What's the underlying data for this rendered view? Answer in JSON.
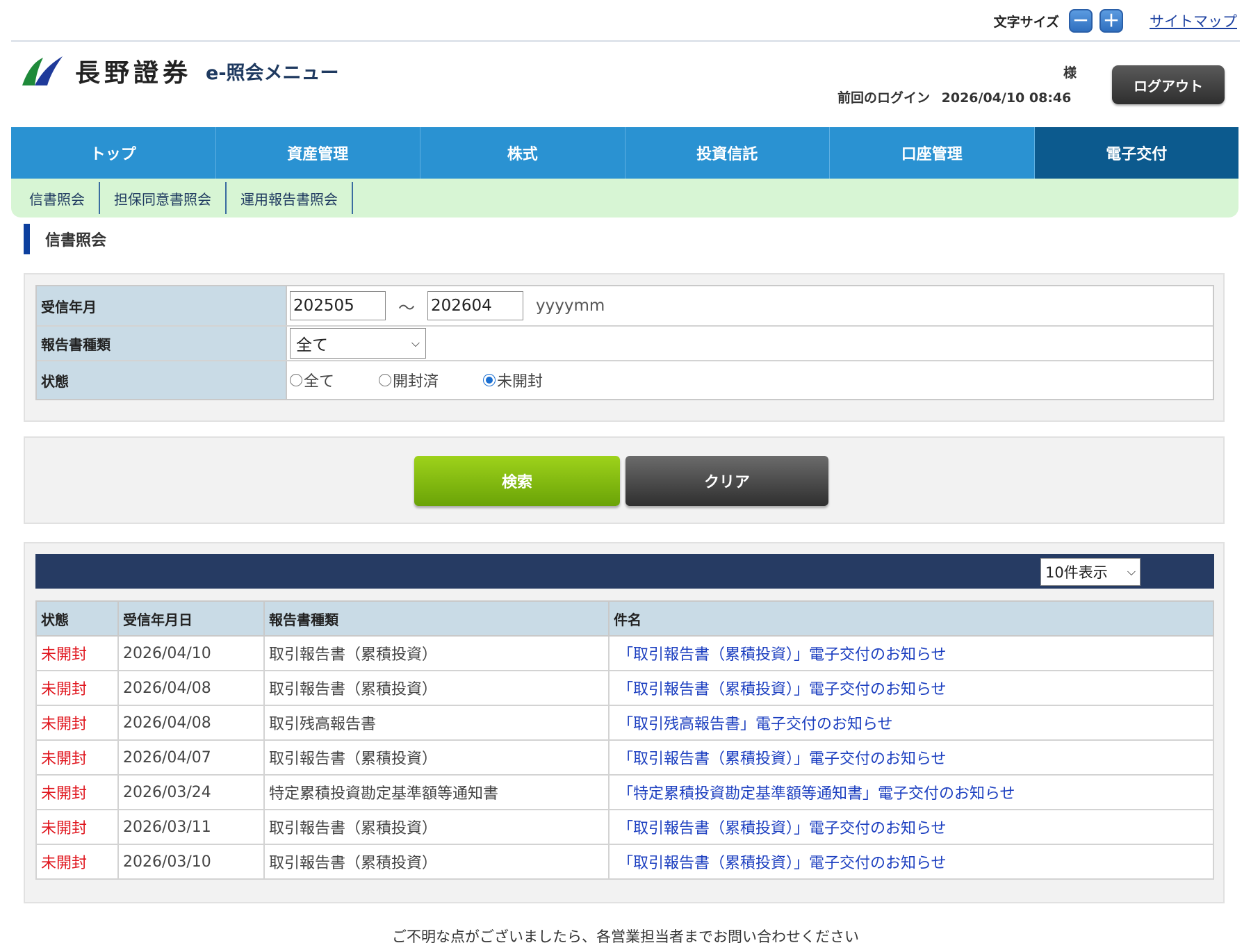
{
  "utility": {
    "font_size_label": "文字サイズ",
    "decrease": "－",
    "increase": "＋",
    "sitemap": "サイトマップ"
  },
  "header": {
    "brand_name": "長野證券",
    "app_name": "e-照会メニュー",
    "honorific": "様",
    "last_login_label": "前回のログイン",
    "last_login_value": "2026/04/10 08:46",
    "logout": "ログアウト"
  },
  "nav": {
    "tabs": [
      {
        "label": "トップ"
      },
      {
        "label": "資産管理"
      },
      {
        "label": "株式"
      },
      {
        "label": "投資信託"
      },
      {
        "label": "口座管理"
      },
      {
        "label": "電子交付",
        "active": true
      }
    ]
  },
  "subnav": {
    "items": [
      {
        "label": "信書照会"
      },
      {
        "label": "担保同意書照会"
      },
      {
        "label": "運用報告書照会"
      }
    ]
  },
  "page_title": "信書照会",
  "search": {
    "period_label": "受信年月",
    "from_value": "202505",
    "tilde": "～",
    "to_value": "202604",
    "format_hint": "yyyymm",
    "type_label": "報告書種類",
    "type_selected": "全て",
    "status_label": "状態",
    "status_options": [
      {
        "label": "全て",
        "checked": false
      },
      {
        "label": "開封済",
        "checked": false
      },
      {
        "label": "未開封",
        "checked": true
      }
    ]
  },
  "buttons": {
    "search": "検索",
    "clear": "クリア"
  },
  "results": {
    "page_size": "10件表示",
    "columns": [
      "状態",
      "受信年月日",
      "報告書種類",
      "件名"
    ],
    "rows": [
      {
        "status": "未開封",
        "date": "2026/04/10",
        "type": "取引報告書（累積投資）",
        "subject": "「取引報告書（累積投資）」電子交付のお知らせ"
      },
      {
        "status": "未開封",
        "date": "2026/04/08",
        "type": "取引報告書（累積投資）",
        "subject": "「取引報告書（累積投資）」電子交付のお知らせ"
      },
      {
        "status": "未開封",
        "date": "2026/04/08",
        "type": "取引残高報告書",
        "subject": "「取引残高報告書」電子交付のお知らせ"
      },
      {
        "status": "未開封",
        "date": "2026/04/07",
        "type": "取引報告書（累積投資）",
        "subject": "「取引報告書（累積投資）」電子交付のお知らせ"
      },
      {
        "status": "未開封",
        "date": "2026/03/24",
        "type": "特定累積投資勘定基準額等通知書",
        "subject": "「特定累積投資勘定基準額等通知書」電子交付のお知らせ"
      },
      {
        "status": "未開封",
        "date": "2026/03/11",
        "type": "取引報告書（累積投資）",
        "subject": "「取引報告書（累積投資）」電子交付のお知らせ"
      },
      {
        "status": "未開封",
        "date": "2026/03/10",
        "type": "取引報告書（累積投資）",
        "subject": "「取引報告書（累積投資）」電子交付のお知らせ"
      }
    ]
  },
  "footer": "ご不明な点がございましたら、各営業担当者までお問い合わせください",
  "colors": {
    "nav": "#2a92d2",
    "nav_active": "#0c5a8e",
    "subnav": "#d7f5d4",
    "table_header": "#c9dbe6",
    "results_bar": "#263b63",
    "unopened": "#e0161e",
    "link": "#1c3fc0",
    "search_button": "#7fba0e"
  }
}
